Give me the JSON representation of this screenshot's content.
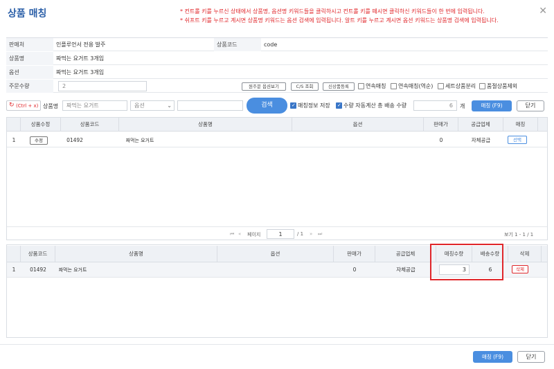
{
  "dialog": {
    "title": "상품 매칭",
    "notice_line1": "* 컨트롤 키를 누르신 상태에서 상품명, 옵션명 키워드들을 클릭하시고 컨트롤 키를 떼시면 클릭하신 키워드들이 한 번에 입력됩니다.",
    "notice_line2": "* 쉬프트 키를 누르고 계시면 상품명 키워드는 옵션 검색에 입력됩니다. 알트 키를 누르고 계시면 옵션 키워드는 상품명 검색에 입력됩니다.",
    "close_icon": "close-icon"
  },
  "form": {
    "seller_label": "판매처",
    "seller_value": "인플루언서 전용 발주",
    "product_code_label": "상품코드",
    "product_code_value": "code",
    "product_name_label": "상품명",
    "product_name_value": "짜먹는 요거트 3개입",
    "option_label": "옵션",
    "option_value": "짜먹는 요거트 3개입",
    "order_qty_label": "주문수량",
    "order_qty_value": "2",
    "btn_view_original": "원주문 옵션보기",
    "btn_cs": "C/S 조회",
    "btn_new_product": "신상품등록",
    "chk_continuous": "연속매칭",
    "chk_continuous_reverse": "연속매칭(역순)",
    "chk_set_split": "세트상품분리",
    "chk_soldout_exclude": "품절상품제외"
  },
  "search": {
    "reset_label": "(Ctrl + x)",
    "product_label": "상품명",
    "product_input": "짜먹는 요거트",
    "option_select": "옵션",
    "search_button": "검색",
    "chk_save_match": "매칭정보 저장",
    "chk_auto_qty": "수량 자동계산 총 배송 수량",
    "total_qty": "6",
    "qty_unit": "개",
    "match_button": "매칭 (F9)",
    "close_button": "닫기"
  },
  "top_grid": {
    "headers": [
      "상품수정",
      "상품코드",
      "상품명",
      "옵션",
      "판매가",
      "공급업체",
      "매칭"
    ],
    "rows": [
      {
        "no": "1",
        "edit": "수정",
        "code": "01492",
        "name": "짜먹는 요거트",
        "option": "",
        "price": "0",
        "supplier": "자체공급",
        "match": "선택"
      }
    ],
    "pager": {
      "page_label": "페이지",
      "page": "1",
      "of": "/ 1",
      "view_info": "보기 1 - 1 / 1"
    }
  },
  "bottom_grid": {
    "headers": [
      "상품코드",
      "상품명",
      "옵션",
      "판매가",
      "공급업체",
      "매칭수량",
      "배송수량",
      "삭제"
    ],
    "rows": [
      {
        "no": "1",
        "code": "01492",
        "name": "짜먹는 요거트",
        "option": "",
        "price": "0",
        "supplier": "자체공급",
        "match_qty": "3",
        "ship_qty": "6",
        "delete": "삭제"
      }
    ]
  },
  "footer": {
    "match_button": "매칭 (F9)",
    "close_button": "닫기"
  },
  "colors": {
    "accent": "#4a8ee0",
    "title": "#2b5fa8",
    "warning": "#e0262a"
  }
}
